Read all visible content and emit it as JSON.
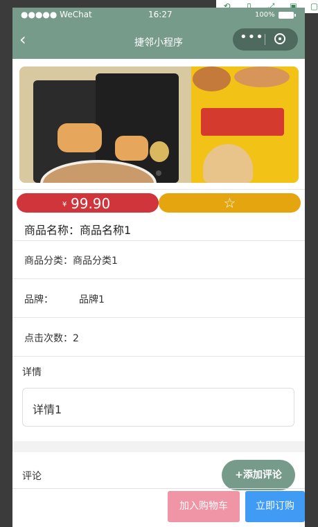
{
  "status_bar": {
    "carrier": "●●●●● WeChat",
    "time": "16:27",
    "battery": "100%"
  },
  "nav": {
    "title": "捷邻小程序",
    "back_icon": "chevron-left-icon",
    "more_icon": "more-dots-icon",
    "close_icon": "target-circle-icon"
  },
  "banner": {
    "image_alt": "product-photo"
  },
  "price": {
    "currency": "¥",
    "value": "99.90",
    "favorite_icon": "star-outline-icon"
  },
  "product": {
    "name_label": "商品名称：",
    "name_value": "商品名称1",
    "category_label": "商品分类：",
    "category_value": "商品分类1",
    "brand_label": "品牌：",
    "brand_value": "品牌1",
    "clicks_label": "点击次数：",
    "clicks_value": "2"
  },
  "detail": {
    "label": "详情",
    "value": "详情1"
  },
  "comments": {
    "label": "评论",
    "add_button": "+添加评论"
  },
  "actions": {
    "add_to_cart": "加入购物车",
    "buy_now": "立即订购"
  },
  "colors": {
    "theme": "#779b8b",
    "price_red": "#d0353b",
    "favorite_gold": "#e5a50e",
    "cart_pink": "#ef95a6",
    "buy_blue": "#3f9bf3"
  }
}
